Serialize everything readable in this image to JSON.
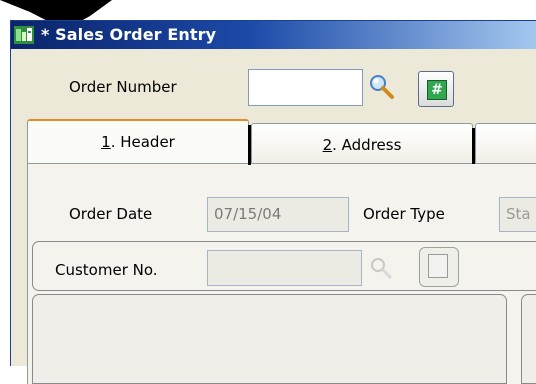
{
  "window": {
    "title": "* Sales Order Entry"
  },
  "order": {
    "label": "Order Number",
    "value": ""
  },
  "tabs": [
    {
      "mnemonic": "1",
      "label": ". Header",
      "active": true
    },
    {
      "mnemonic": "2",
      "label": ". Address",
      "active": false
    }
  ],
  "header": {
    "order_date_label": "Order Date",
    "order_date_value": "07/15/04",
    "order_type_label": "Order Type",
    "order_type_value": "Sta",
    "customer_label": "Customer No.",
    "customer_value": ""
  },
  "icons": {
    "app": "sales-order-app-icon",
    "search": "magnifier-search-icon",
    "hash": "hash-number-icon",
    "customer_search": "magnifier-search-icon-disabled"
  },
  "colors": {
    "titlebar_start": "#0a246a",
    "titlebar_end": "#a6caf0",
    "window_bg": "#ece9d8",
    "active_tab_highlight": "#e68b2c",
    "hash_icon": "#2fa84f"
  }
}
